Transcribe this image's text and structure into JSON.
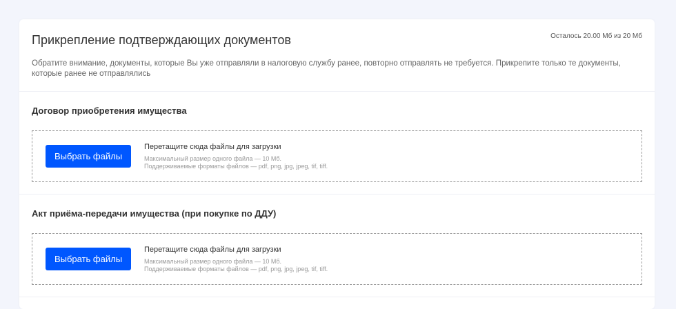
{
  "header": {
    "title": "Прикрепление подтверждающих документов",
    "remaining": "Осталось 20.00 Мб из 20 Мб",
    "description": "Обратите внимание, документы, которые Вы уже отправляли в налоговую службу ранее, повторно отправлять не требуется. Прикрепите только те документы, которые ранее не отправлялись"
  },
  "sections": [
    {
      "title": "Договор приобретения имущества",
      "button": "Выбрать файлы",
      "drop_text": "Перетащите сюда файлы для загрузки",
      "max_size": "Максимальный размер одного файла — 10 Мб.",
      "formats": "Поддерживаемые форматы файлов — pdf, png, jpg, jpeg, tif, tiff."
    },
    {
      "title": "Акт приёма-передачи имущества (при покупке по ДДУ)",
      "button": "Выбрать файлы",
      "drop_text": "Перетащите сюда файлы для загрузки",
      "max_size": "Максимальный размер одного файла — 10 Мб.",
      "formats": "Поддерживаемые форматы файлов — pdf, png, jpg, jpeg, tif, tiff."
    }
  ],
  "colors": {
    "accent": "#0057ff",
    "background": "#f3f5fc"
  }
}
